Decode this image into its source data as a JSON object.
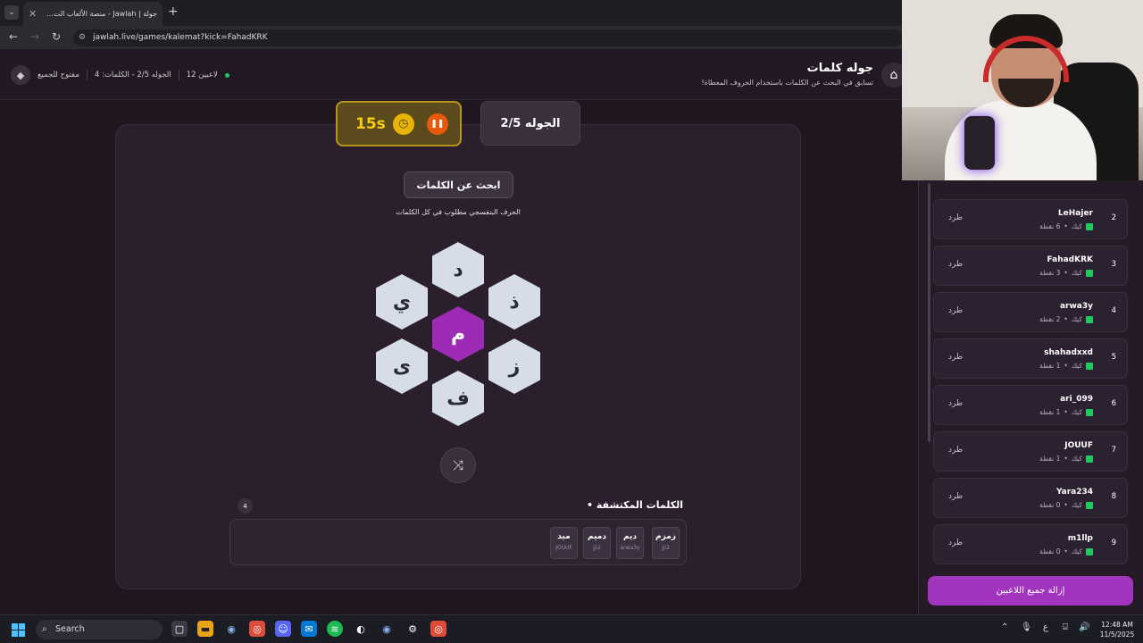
{
  "browser": {
    "tab_title": "جولة | Jawlah - منصة الألعاب الت...",
    "tab_extra": "جولة",
    "url": "jawlah.live/games/kalemat?kick=FahadKRK"
  },
  "header": {
    "title": "جوله كلمات",
    "subtitle": "تسابق في البحث عن الكلمات باستخدام الحروف المعطاة!",
    "players_count": "12 لاعبين",
    "round_info": "الجوله 2/5 - الكلمات: 4",
    "open_status": "مفتوح للجميع"
  },
  "game": {
    "round_label": "الجوله 2/5",
    "timer": "15s",
    "search_title": "ابحث عن الكلمات",
    "hint": "الحرف البنفسجي مطلوب في كل الكلمات",
    "center_letter": "م",
    "letters": [
      "د",
      "ذ",
      "ز",
      "ف",
      "ى",
      "ي"
    ],
    "found_title": "الكلمات المكتشفة",
    "found_count": "4",
    "found_words": [
      {
        "word": "زمزم",
        "user": "jji2"
      },
      {
        "word": "ديم",
        "user": "arwa3y"
      },
      {
        "word": "دميم",
        "user": "jji2"
      },
      {
        "word": "ميد",
        "user": "JOUUF"
      }
    ]
  },
  "players": [
    {
      "rank": "2",
      "name": "LeHajer",
      "score": "6 نقطة",
      "kick_label": "كيك",
      "action": "طرد"
    },
    {
      "rank": "3",
      "name": "FahadKRK",
      "score": "3 نقطة",
      "kick_label": "كيك",
      "action": "طرد"
    },
    {
      "rank": "4",
      "name": "arwa3y",
      "score": "2 نقطة",
      "kick_label": "كيك",
      "action": "طرد"
    },
    {
      "rank": "5",
      "name": "shahadxxd",
      "score": "1 نقطة",
      "kick_label": "كيك",
      "action": "طرد"
    },
    {
      "rank": "6",
      "name": "ari_099",
      "score": "1 نقطة",
      "kick_label": "كيك",
      "action": "طرد"
    },
    {
      "rank": "7",
      "name": "JOUUF",
      "score": "1 نقطة",
      "kick_label": "كيك",
      "action": "طرد"
    },
    {
      "rank": "8",
      "name": "Yara234",
      "score": "0 نقطة",
      "kick_label": "كيك",
      "action": "طرد"
    },
    {
      "rank": "9",
      "name": "m1llp",
      "score": "0 نقطة",
      "kick_label": "كيك",
      "action": "طرد"
    }
  ],
  "remove_all_label": "إزالة جميع اللاعبين",
  "taskbar": {
    "search": "Search",
    "lang": "ع",
    "time": "12:48 AM",
    "date": "11/5/2025"
  },
  "colors": {
    "accent": "#9d2bb5",
    "timer": "#facc15",
    "kick": "#22c55e"
  }
}
